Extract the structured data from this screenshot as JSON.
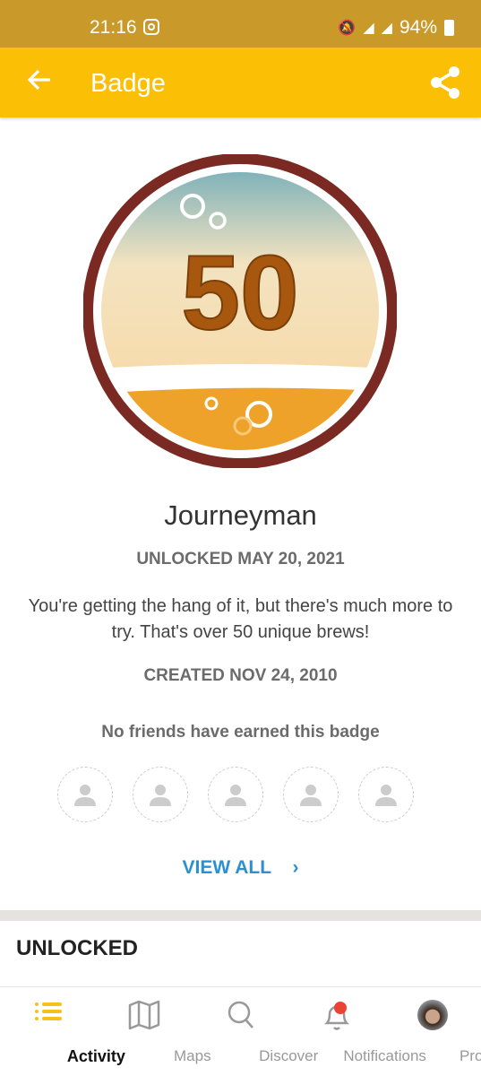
{
  "status_bar": {
    "time": "21:16",
    "battery": "94%",
    "network": "4G"
  },
  "app_bar": {
    "title": "Badge",
    "back_icon": "arrow-left-icon",
    "share_icon": "share-icon"
  },
  "badge": {
    "number": "50",
    "name": "Journeyman",
    "unlocked": "UNLOCKED MAY 20, 2021",
    "description": "You're getting the hang of it, but there's much more to try. That's over 50 unique brews!",
    "created": "CREATED NOV 24, 2010",
    "friends_text": "No friends have earned this badge",
    "view_all": "VIEW ALL",
    "colors": {
      "ring": "#7a2a22",
      "number": "#a8580e"
    }
  },
  "section": {
    "title": "UNLOCKED"
  },
  "nav": {
    "items": [
      {
        "label": "Activity",
        "icon": "list-icon",
        "active": true
      },
      {
        "label": "Maps",
        "icon": "map-icon"
      },
      {
        "label": "Discover",
        "icon": "search-icon"
      },
      {
        "label": "Notifications",
        "icon": "bell-icon",
        "badge_dot": true
      },
      {
        "label": "Profile",
        "icon": "avatar"
      }
    ]
  },
  "colors": {
    "status_bar": "#c99a2a",
    "app_bar": "#fbbf05",
    "link": "#2d8fd0"
  }
}
